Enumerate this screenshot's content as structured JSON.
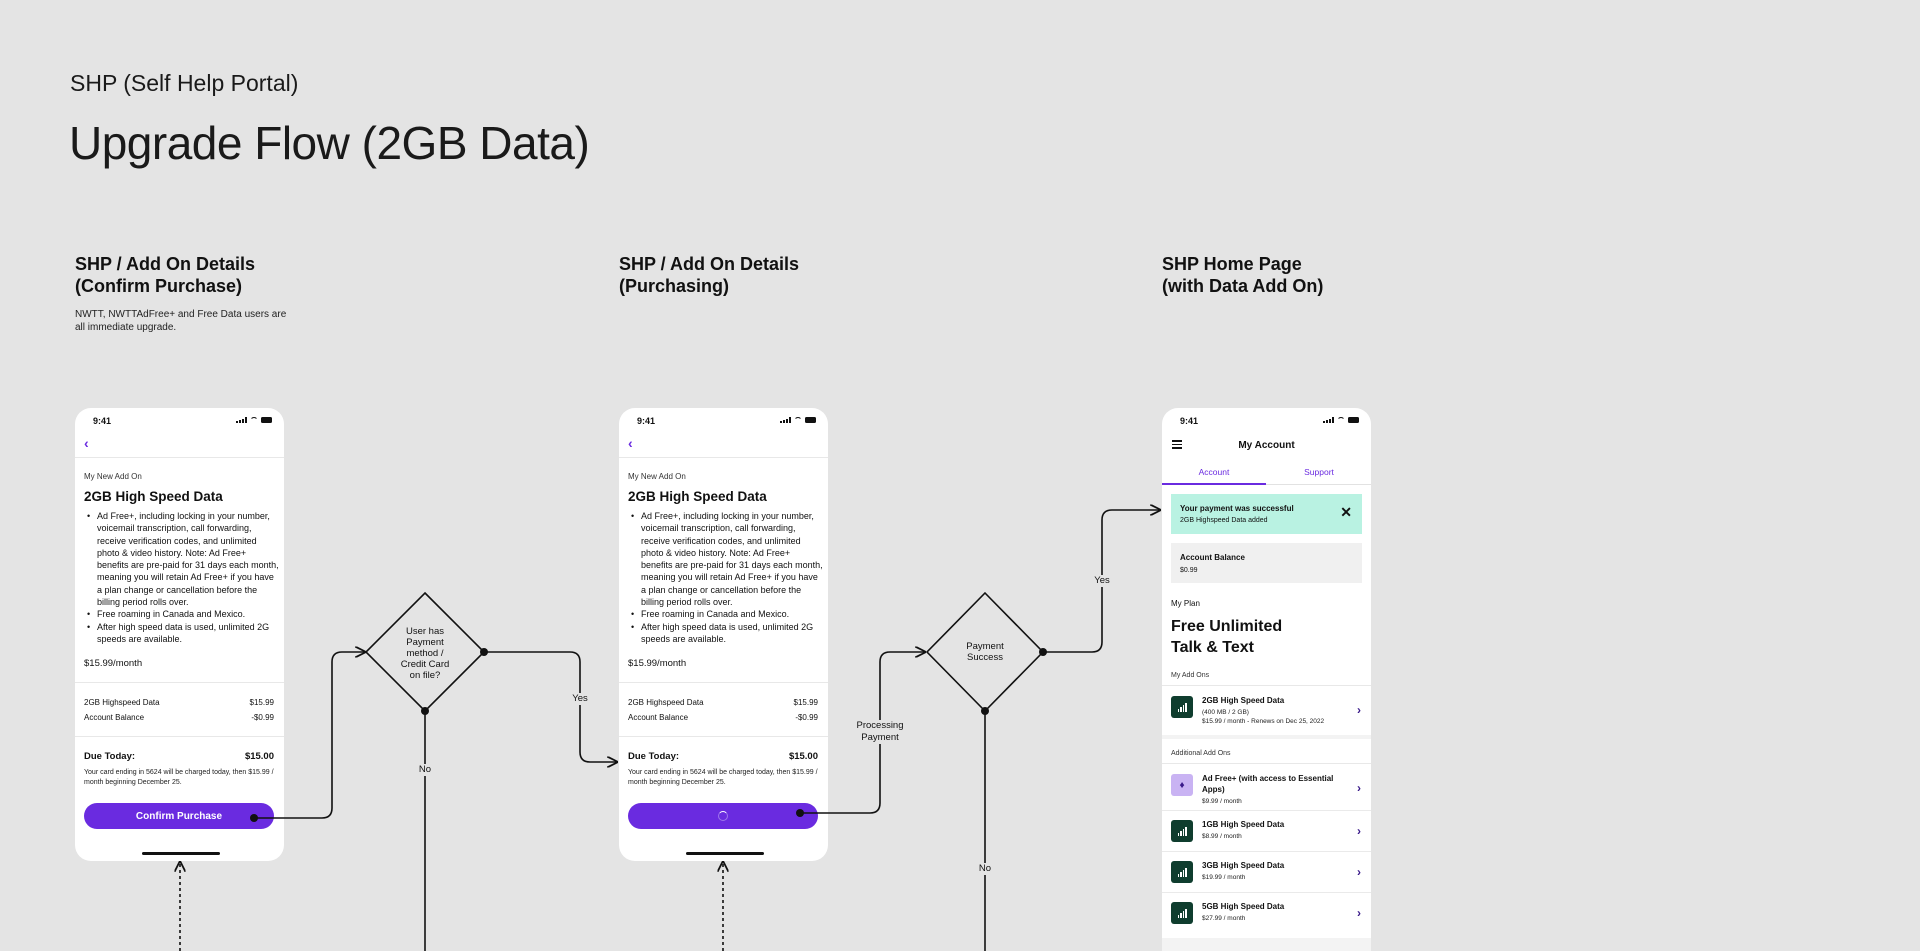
{
  "header": {
    "kicker": "SHP (Self Help Portal)",
    "title": "Upgrade Flow (2GB Data)"
  },
  "columns": [
    {
      "title": "SHP / Add On Details\n(Confirm Purchase)",
      "note": "NWTT, NWTTAdFree+ and Free Data users are all immediate upgrade."
    },
    {
      "title": "SHP / Add On Details\n(Purchasing)"
    },
    {
      "title": "SHP Home Page\n(with Data Add On)"
    }
  ],
  "status_time": "9:41",
  "addon_screen": {
    "label": "My New Add On",
    "name": "2GB High Speed Data",
    "bullets": [
      "Ad Free+, including locking in your number, voicemail transcription, call forwarding, receive verification codes, and unlimited photo & video history. Note: Ad Free+ benefits are pre-paid for 31 days each month, meaning you will retain Ad Free+ if you have a plan change or cancellation before the billing period rolls over.",
      "Free roaming in Canada and Mexico.",
      "After high speed data is used, unlimited 2G speeds are available."
    ],
    "price": "$15.99/month",
    "line_items": [
      {
        "label": "2GB Highspeed Data",
        "amount": "$15.99"
      },
      {
        "label": "Account Balance",
        "amount": "-$0.99"
      }
    ],
    "due_label": "Due Today:",
    "due_amount": "$15.00",
    "fine_print": "Your card ending in 5624 will be charged today, then $15.99 / month beginning December 25.",
    "confirm_label": "Confirm Purchase"
  },
  "home_screen": {
    "title": "My Account",
    "tabs": [
      "Account",
      "Support"
    ],
    "toast_title": "Your payment was successful",
    "toast_sub": "2GB Highspeed Data added",
    "balance_label": "Account Balance",
    "balance_value": "$0.99",
    "plan_label": "My Plan",
    "plan_name": "Free Unlimited\nTalk & Text",
    "my_addons_label": "My Add Ons",
    "my_addons": [
      {
        "name": "2GB High Speed Data",
        "sub1": "(400 MB / 2 GB)",
        "sub2": "$15.99 / month - Renews on Dec 25, 2022",
        "icon": "signal-icon"
      }
    ],
    "additional_label": "Additional Add Ons",
    "additional_addons": [
      {
        "name": "Ad Free+ (with access to Essential Apps)",
        "sub": "$9.99 / month",
        "icon": "gem-icon"
      },
      {
        "name": "1GB High Speed Data",
        "sub": "$8.99 / month",
        "icon": "signal-icon"
      },
      {
        "name": "3GB High Speed Data",
        "sub": "$19.99 / month",
        "icon": "signal-icon"
      },
      {
        "name": "5GB High Speed Data",
        "sub": "$27.99 / month",
        "icon": "signal-icon"
      }
    ]
  },
  "flow": {
    "decision1": "User has\nPayment\nmethod /\nCredit Card\non file?",
    "decision2": "Payment\nSuccess",
    "yes_label": "Yes",
    "no_label": "No",
    "processing_label": "Processing\nPayment"
  },
  "colors": {
    "accent": "#6a2be0",
    "toast": "#b9f2e2",
    "icon_bg": "#0f3d2e",
    "background": "#e4e4e4"
  }
}
